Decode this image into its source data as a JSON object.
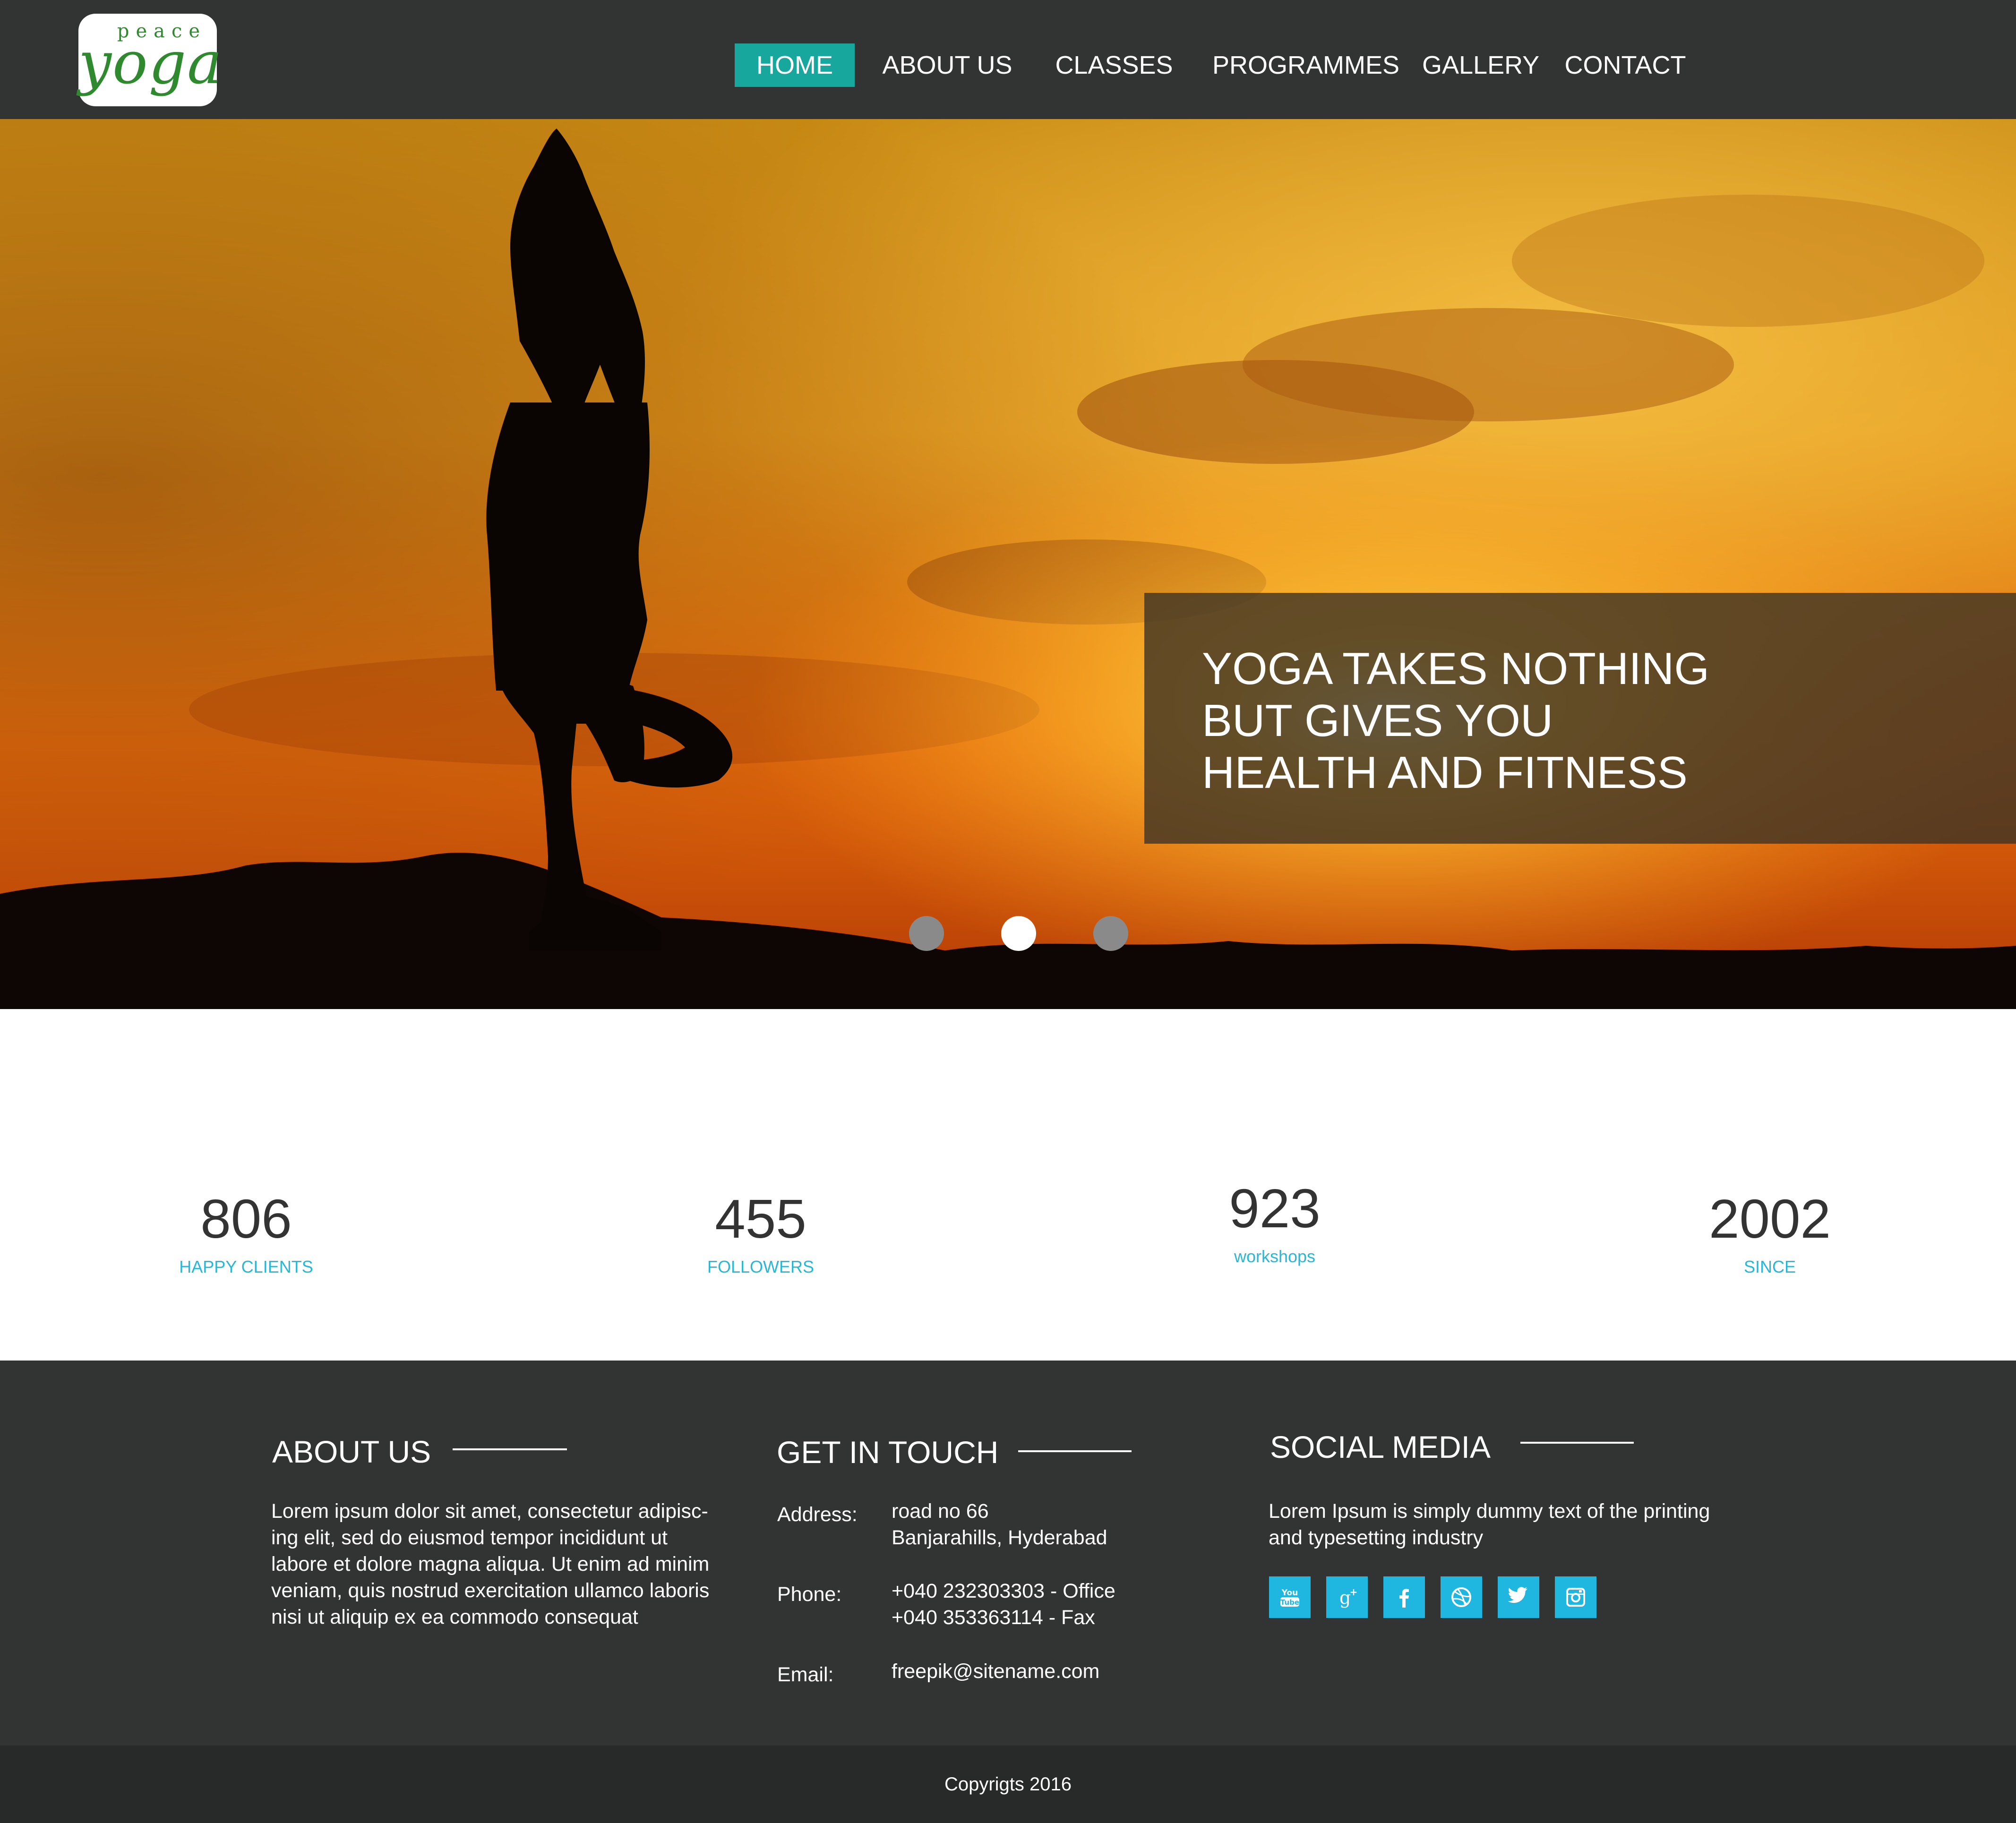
{
  "header": {
    "logo": {
      "small": "peace",
      "main": "yoga"
    },
    "nav": [
      {
        "label": "HOME",
        "active": true
      },
      {
        "label": "ABOUT US",
        "active": false
      },
      {
        "label": "CLASSES",
        "active": false
      },
      {
        "label": "PROGRAMMES",
        "active": false
      },
      {
        "label": "GALLERY",
        "active": false
      },
      {
        "label": "CONTACT",
        "active": false
      }
    ]
  },
  "hero": {
    "caption_lines": [
      "YOGA TAKES NOTHING",
      "BUT GIVES YOU",
      "HEALTH AND FITNESS"
    ],
    "slider": {
      "count": 3,
      "active_index": 1
    }
  },
  "stats": [
    {
      "value": "806",
      "label": "HAPPY CLIENTS"
    },
    {
      "value": "455",
      "label": "FOLLOWERS"
    },
    {
      "value": "923",
      "label": "workshops"
    },
    {
      "value": "2002",
      "label": "SINCE"
    }
  ],
  "footer": {
    "about": {
      "title": "ABOUT US",
      "lines": [
        "Lorem ipsum dolor sit amet, consectetur adipisc-",
        "ing elit, sed do eiusmod tempor incididunt ut",
        "labore et dolore magna aliqua. Ut enim ad minim",
        "veniam, quis nostrud exercitation ullamco laboris",
        "nisi ut aliquip ex ea commodo consequat"
      ]
    },
    "contact": {
      "title": "GET IN TOUCH",
      "address_label": "Address:",
      "address_lines": [
        "road no 66",
        "Banjarahills, Hyderabad"
      ],
      "phone_label": "Phone:",
      "phone_lines": [
        "+040 232303303 - Office",
        "+040 353363114 - Fax"
      ],
      "email_label": "Email:",
      "email": "freepik@sitename.com"
    },
    "social": {
      "title": "SOCIAL MEDIA",
      "lines": [
        "Lorem Ipsum is simply dummy text of the printing",
        "and typesetting industry"
      ],
      "icons": [
        "youtube-icon",
        "google-plus-icon",
        "facebook-icon",
        "dribbble-icon",
        "twitter-icon",
        "instagram-icon"
      ],
      "icon_color": "#1fb6e0"
    },
    "copyright": "Copyrigts 2016"
  },
  "colors": {
    "header_bg": "#323333",
    "accent": "#17a79d",
    "stat_label": "#29b7d6",
    "footer_bg": "#323333",
    "copyright_bg": "#282929"
  }
}
